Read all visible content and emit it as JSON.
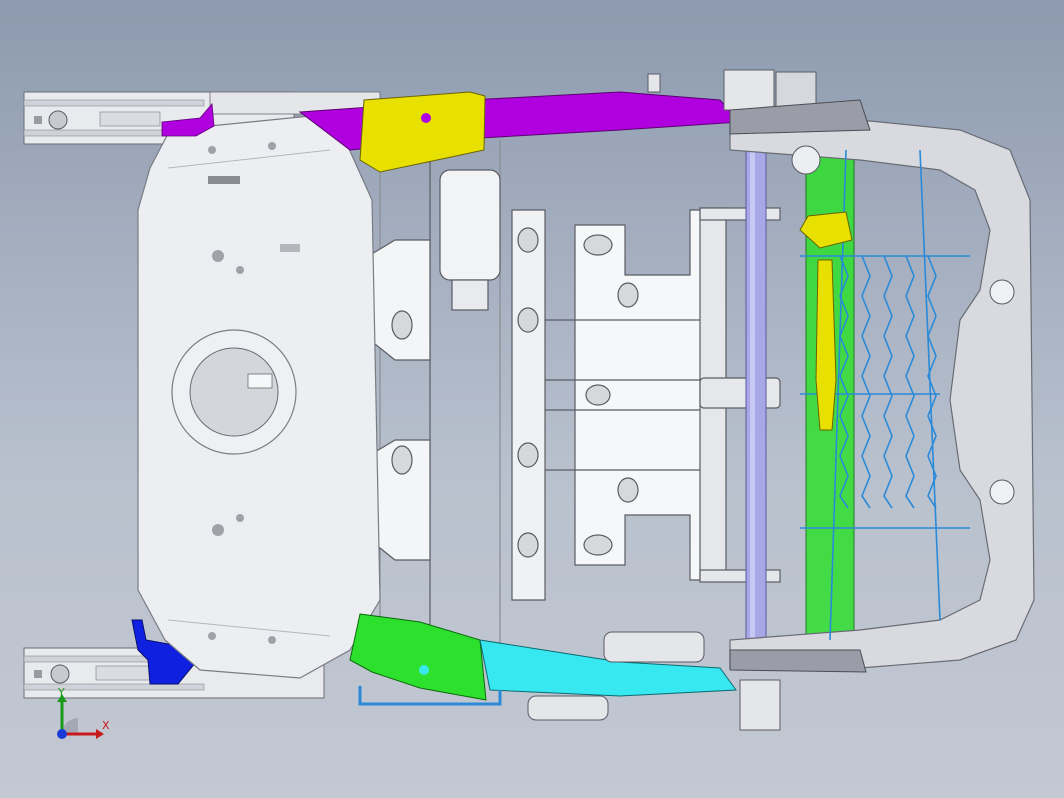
{
  "viewport": {
    "background_top": "#8d9aaf",
    "background_bottom": "#c3c8d2"
  },
  "parts": {
    "rail_color": "#e8eaee",
    "pan_color": "#eceef2",
    "frame_color": "#d8dae0",
    "bracket_yellow": "#e8e000",
    "link_magenta": "#b000e0",
    "bracket_green": "#2ee02e",
    "link_cyan": "#38e8f0",
    "spring_blue": "#2a8ad8",
    "tube_lavender": "#a8a8e8",
    "lever_blue": "#1020e0",
    "hinge_grey": "#9a9ca8"
  },
  "triad": {
    "x_label": "X",
    "y_label": "Y",
    "x_color": "#c81a1a",
    "y_color": "#1a9a1a",
    "z_color": "#1a3ad8"
  }
}
